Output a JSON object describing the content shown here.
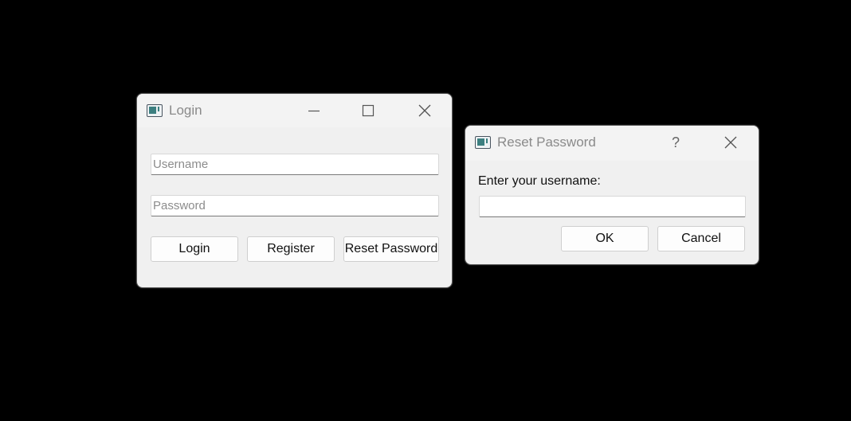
{
  "login_window": {
    "title": "Login",
    "username_placeholder": "Username",
    "username_value": "",
    "password_placeholder": "Password",
    "password_value": "",
    "buttons": {
      "login": "Login",
      "register": "Register",
      "reset_password": "Reset Password"
    },
    "caption_buttons": [
      "minimize-icon",
      "maximize-icon",
      "close-icon"
    ],
    "app_icon": "window-app-icon"
  },
  "reset_dialog": {
    "title": "Reset Password",
    "prompt": "Enter your username:",
    "username_value": "",
    "help_glyph": "?",
    "buttons": {
      "ok": "OK",
      "cancel": "Cancel"
    },
    "caption_buttons": [
      "help-icon",
      "close-icon"
    ],
    "app_icon": "window-app-icon"
  },
  "colors": {
    "desktop_background": "#000000",
    "window_background": "#f0f0f0",
    "title_text": "#8a8a8a",
    "icon_accent": "#3c7f80"
  }
}
